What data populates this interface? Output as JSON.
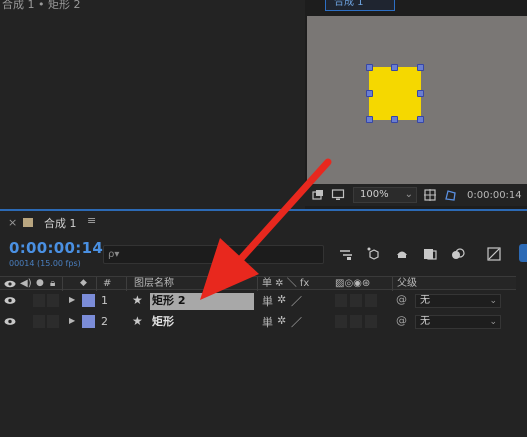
{
  "project": {
    "breadcrumb": "合成 1 • 矩形 2"
  },
  "viewer": {
    "tab_label": "合成 1",
    "zoom": "100%",
    "time": "0:00:00:14",
    "shape_color": "#f5d800",
    "canvas_color": "#7a7775"
  },
  "timeline": {
    "close_label": "×",
    "comp_name": "合成 1",
    "menu_label": "≡",
    "timecode": "0:00:00:14",
    "fps": "00014 (15.00 fps)",
    "search_placeholder": "ρ▾",
    "columns": {
      "num": "#",
      "layer_name": "图层名称",
      "switches": "单 ✲ ＼ fx",
      "parent": "父级"
    },
    "layers": [
      {
        "num": "1",
        "name": "矩形 2",
        "parent": "无",
        "label_color": "#7b8cd8",
        "selected": true
      },
      {
        "num": "2",
        "name": "矩形",
        "parent": "无",
        "label_color": "#7b8cd8",
        "selected": false
      }
    ]
  },
  "annotation": {
    "arrow_color": "#e8281e"
  }
}
